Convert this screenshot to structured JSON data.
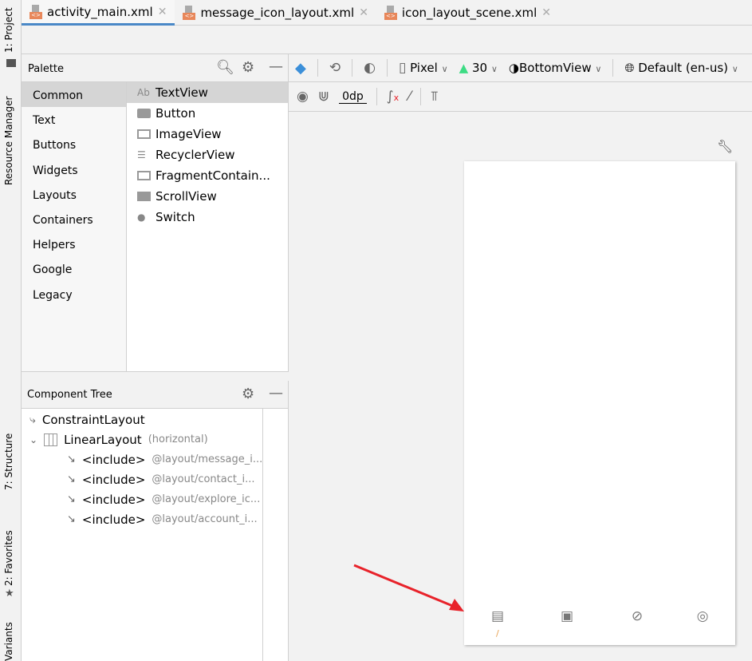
{
  "side_strip": {
    "project": "1: Project",
    "resource_manager": "Resource Manager",
    "structure": "7: Structure",
    "favorites": "2: Favorites",
    "variants": "Variants"
  },
  "tabs": [
    {
      "label": "activity_main.xml",
      "active": true
    },
    {
      "label": "message_icon_layout.xml"
    },
    {
      "label": "icon_layout_scene.xml"
    }
  ],
  "palette": {
    "title": "Palette",
    "categories": [
      "Common",
      "Text",
      "Buttons",
      "Widgets",
      "Layouts",
      "Containers",
      "Helpers",
      "Google",
      "Legacy"
    ],
    "items": [
      {
        "label": "TextView",
        "icon": "Ab"
      },
      {
        "label": "Button",
        "icon": "button-icon"
      },
      {
        "label": "ImageView",
        "icon": "image-icon"
      },
      {
        "label": "RecyclerView",
        "icon": "list-icon"
      },
      {
        "label": "FragmentContain...",
        "icon": "fragment-icon"
      },
      {
        "label": "ScrollView",
        "icon": "scroll-icon"
      },
      {
        "label": "Switch",
        "icon": "switch-icon"
      }
    ]
  },
  "component_tree": {
    "title": "Component Tree",
    "root": "ConstraintLayout",
    "linear": "LinearLayout",
    "linear_hint": "(horizontal)",
    "includes": [
      {
        "tag": "<include>",
        "ref": "@layout/message_i..."
      },
      {
        "tag": "<include>",
        "ref": "@layout/contact_i..."
      },
      {
        "tag": "<include>",
        "ref": "@layout/explore_ic..."
      },
      {
        "tag": "<include>",
        "ref": "@layout/account_i..."
      }
    ]
  },
  "toolbar": {
    "device": "Pixel",
    "api": "30",
    "theme": "BottomView",
    "locale": "Default (en-us)",
    "margin": "0dp"
  },
  "colors": {
    "accent": "#4a88c7",
    "arrow": "#e8222a",
    "android": "#3ddc84"
  }
}
